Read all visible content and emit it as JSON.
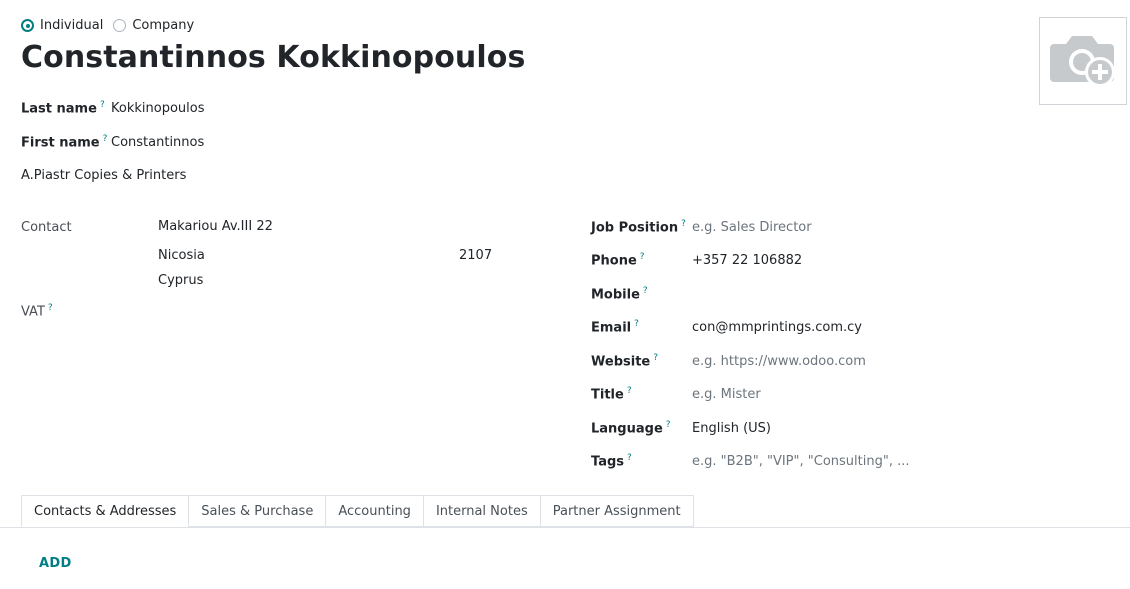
{
  "type_selector": {
    "options": [
      {
        "label": "Individual",
        "checked": true
      },
      {
        "label": "Company",
        "checked": false
      }
    ]
  },
  "name": "Constantinnos Kokkinopoulos",
  "fields": {
    "last_name": {
      "label": "Last name",
      "value": "Kokkinopoulos"
    },
    "first_name": {
      "label": "First name",
      "value": "Constantinnos"
    },
    "company": "A.Piastr Copies & Printers"
  },
  "address": {
    "label": "Contact",
    "street": "Makariou Av.III 22",
    "city": "Nicosia",
    "zip": "2107",
    "country": "Cyprus",
    "vat_label": "VAT"
  },
  "right_fields": {
    "job_position": {
      "label": "Job Position",
      "placeholder": "e.g. Sales Director"
    },
    "phone": {
      "label": "Phone",
      "value": "+357 22 106882"
    },
    "mobile": {
      "label": "Mobile",
      "value": ""
    },
    "email": {
      "label": "Email",
      "value": "con@mmprintings.com.cy"
    },
    "website": {
      "label": "Website",
      "placeholder": "e.g. https://www.odoo.com"
    },
    "title": {
      "label": "Title",
      "placeholder": "e.g. Mister"
    },
    "language": {
      "label": "Language",
      "value": "English (US)"
    },
    "tags": {
      "label": "Tags",
      "placeholder": "e.g. \"B2B\", \"VIP\", \"Consulting\", ..."
    }
  },
  "help_mark": "?",
  "tabs": [
    {
      "label": "Contacts & Addresses",
      "active": true
    },
    {
      "label": "Sales & Purchase",
      "active": false
    },
    {
      "label": "Accounting",
      "active": false
    },
    {
      "label": "Internal Notes",
      "active": false
    },
    {
      "label": "Partner Assignment",
      "active": false
    }
  ],
  "add_label": "ADD",
  "colors": {
    "accent": "#017e84",
    "text": "#212529",
    "placeholder": "#6c757d"
  },
  "icons": {
    "avatar": "camera-add-icon"
  }
}
